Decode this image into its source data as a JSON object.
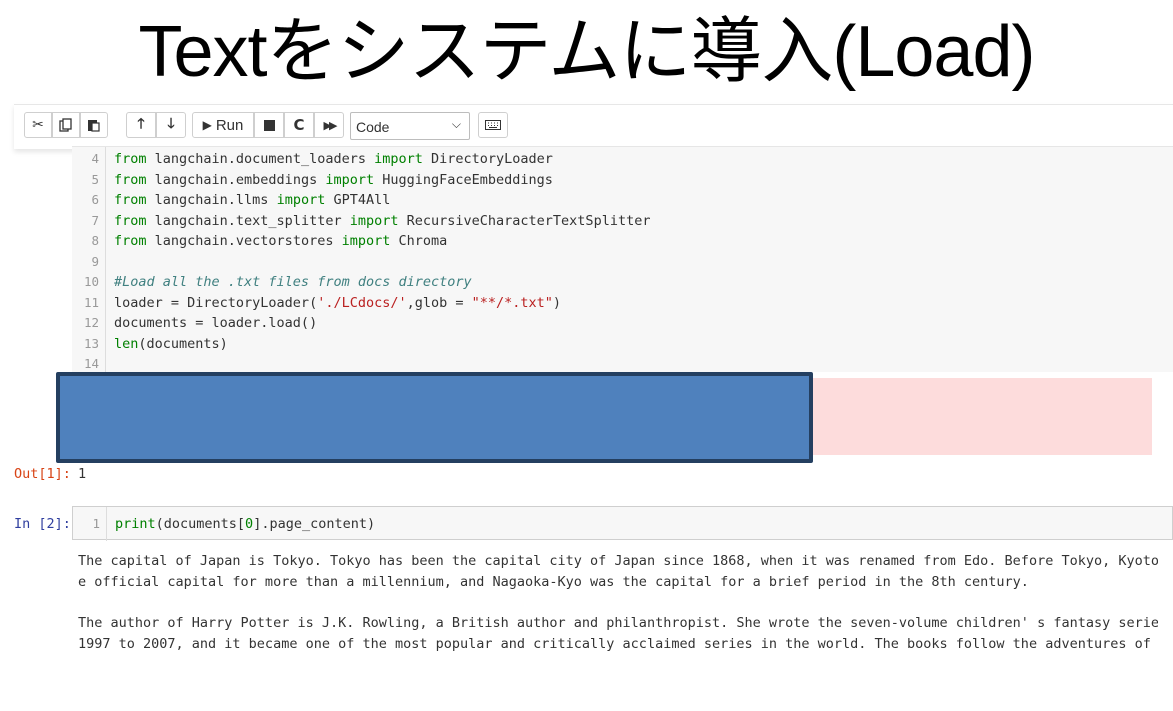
{
  "slide": {
    "title": "Textをシステムに導入(Load)"
  },
  "toolbar": {
    "run_label": "Run",
    "cell_type_selected": "Code",
    "icons": [
      "cut-icon",
      "copy-icon",
      "paste-icon",
      "move-up-icon",
      "move-down-icon",
      "run-icon",
      "stop-icon",
      "restart-icon",
      "run-all-icon",
      "keyboard-icon"
    ]
  },
  "code_cell": {
    "lines": [
      {
        "num": "4",
        "segments": [
          [
            "kw",
            "from"
          ],
          [
            "pl",
            " langchain.document_loaders "
          ],
          [
            "kw",
            "import"
          ],
          [
            "pl",
            " DirectoryLoader"
          ]
        ]
      },
      {
        "num": "5",
        "segments": [
          [
            "kw",
            "from"
          ],
          [
            "pl",
            " langchain.embeddings "
          ],
          [
            "kw",
            "import"
          ],
          [
            "pl",
            " HuggingFaceEmbeddings"
          ]
        ]
      },
      {
        "num": "6",
        "segments": [
          [
            "kw",
            "from"
          ],
          [
            "pl",
            " langchain.llms "
          ],
          [
            "kw",
            "import"
          ],
          [
            "pl",
            " GPT4All"
          ]
        ]
      },
      {
        "num": "7",
        "segments": [
          [
            "kw",
            "from"
          ],
          [
            "pl",
            " langchain.text_splitter "
          ],
          [
            "kw",
            "import"
          ],
          [
            "pl",
            " RecursiveCharacterTextSplitter"
          ]
        ]
      },
      {
        "num": "8",
        "segments": [
          [
            "kw",
            "from"
          ],
          [
            "pl",
            " langchain.vectorstores "
          ],
          [
            "kw",
            "import"
          ],
          [
            "pl",
            " Chroma"
          ]
        ]
      },
      {
        "num": "9",
        "segments": []
      },
      {
        "num": "10",
        "segments": [
          [
            "cm",
            "#Load all the .txt files from docs directory"
          ]
        ]
      },
      {
        "num": "11",
        "segments": [
          [
            "pl",
            "loader = DirectoryLoader("
          ],
          [
            "str",
            "'./LCdocs/'"
          ],
          [
            "pl",
            ",glob = "
          ],
          [
            "str",
            "\"**/*.txt\""
          ],
          [
            "pl",
            ")"
          ]
        ]
      },
      {
        "num": "12",
        "segments": [
          [
            "pl",
            "documents = loader.load()"
          ]
        ]
      },
      {
        "num": "13",
        "segments": [
          [
            "bi",
            "len"
          ],
          [
            "pl",
            "(documents)"
          ]
        ]
      },
      {
        "num": "14",
        "segments": []
      }
    ]
  },
  "output_1": {
    "prompt": "Out[1]:",
    "value": "1"
  },
  "input_2": {
    "prompt": "In [2]:",
    "line_num": "1",
    "code_func": "print",
    "code_args_1": "(documents[",
    "code_index": "0",
    "code_args_2": "].page_content)"
  },
  "stdout": {
    "lines": [
      "The capital of Japan is Tokyo. Tokyo has been the capital city of Japan since 1868, when it was renamed from Edo. Before Tokyo, Kyoto was th",
      "e official capital for more than a millennium, and Nagaoka-Kyo was the capital for a brief period in the 8th century.",
      "",
      "The author of Harry Potter is J.K. Rowling, a British author and philanthropist. She wrote the seven-volume children' s fantasy series from",
      "1997 to 2007, and it became one of the most popular and critically acclaimed series in the world. The books follow the adventures of Harry P"
    ]
  },
  "colors": {
    "keyword": "#008000",
    "string": "#ba2121",
    "comment": "#408080",
    "error_bg": "#fddcdc",
    "redaction_fill": "#4f81bd",
    "redaction_border": "#243f60",
    "out_prompt": "#d84315",
    "in_prompt": "#303f9f"
  }
}
